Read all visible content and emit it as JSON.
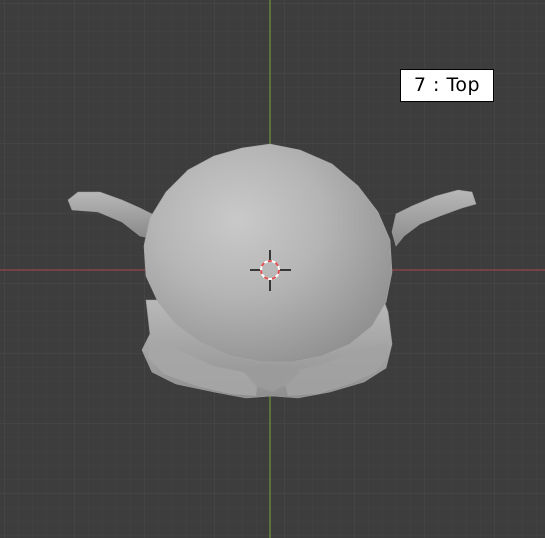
{
  "viewport": {
    "view_label": "7 : Top",
    "background_color": "#3d3d3d",
    "grid_minor_color": "#434343",
    "grid_major_color": "#4a4a4a",
    "x_axis_color": "#b04444",
    "y_axis_color": "#7fae3c",
    "mesh_color": "#b2b2b2",
    "cursor_colors": [
      "#000000",
      "#ffffff",
      "#e05050"
    ]
  },
  "icons": {
    "cursor": "3d-cursor-icon",
    "object": "mesh-object"
  }
}
